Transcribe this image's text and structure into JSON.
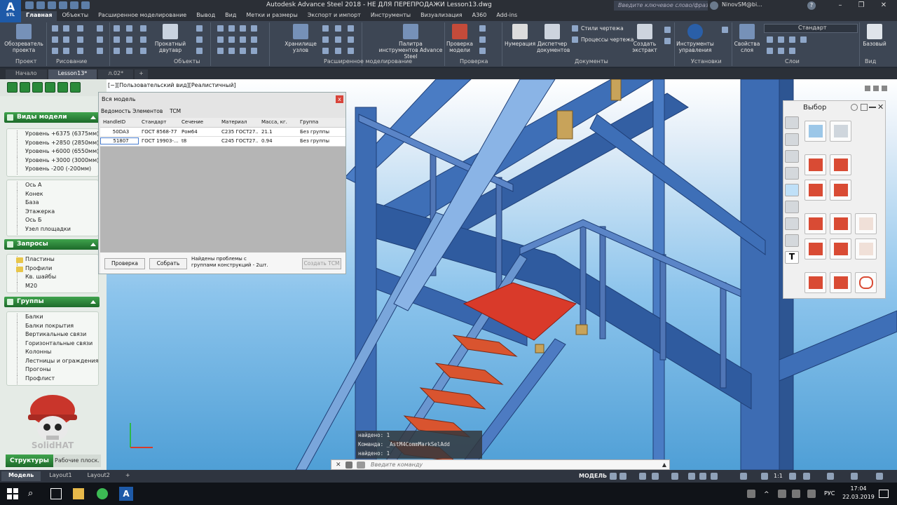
{
  "window": {
    "title": "Autodesk Advance Steel 2018 - НЕ ДЛЯ ПЕРЕПРОДАЖИ    Lesson13.dwg",
    "logo": "A",
    "logo_sub": "STL",
    "search_placeholder": "Введите ключевое слово/фразу",
    "user": "NinovSM@bi...",
    "minimize": "–",
    "restore": "❐",
    "close": "✕"
  },
  "ribbon_tabs": [
    "Главная",
    "Объекты",
    "Расширенное моделирование",
    "Вывод",
    "Вид",
    "Метки и размеры",
    "Экспорт и импорт",
    "Инструменты",
    "Визуализация",
    "A360",
    "Add-ins"
  ],
  "ribbon": {
    "buttons": {
      "project_browser": "Обозреватель проекта",
      "rolled_beam": "Прокатный двутавр",
      "storage_nodes": "Хранилище узлов",
      "tool_palette": "Палитра инструментов Advance Steel",
      "model_check": "Проверка модели",
      "numbering": "Нумерация",
      "doc_manager": "Диспетчер документов",
      "drawing_styles": "Стили чертежа",
      "drawing_processes": "Процессы чертежа",
      "create_extract": "Создать экстракт",
      "management_tools": "Инструменты управления",
      "layer_props": "Свойства слоя",
      "base": "Базовый",
      "layer_state": "Стандарт"
    },
    "groups": [
      "Проект",
      "Рисование",
      "Объекты",
      "Расширенное моделирование",
      "Проверка",
      "Документы",
      "Установки",
      "Слои",
      "Вид"
    ]
  },
  "doc_tabs": [
    "Начало",
    "Lesson13*",
    "л.02*"
  ],
  "left_panel": {
    "views_header": "Виды модели",
    "levels": [
      "Уровень +6375 (6375мм)",
      "Уровень +2850 (2850мм)",
      "Уровень +6000 (6550мм)",
      "Уровень +3000 (3000мм)",
      "Уровень -200 (-200мм)"
    ],
    "axes": [
      "Ось А",
      "Конек",
      "База",
      "Этажерка",
      "Ось Б",
      "Узел площадки"
    ],
    "queries_header": "Запросы",
    "queries": [
      "Пластины",
      "Профили",
      "Кв. шайбы",
      "M20"
    ],
    "groups_header": "Группы",
    "groups": [
      "Балки",
      "Балки покрытия",
      "Вертикальные связи",
      "Горизонтальные связи",
      "Колонны",
      "Лестницы и ограждения",
      "Прогоны",
      "Профлист"
    ],
    "mascot_text": "SolidHAT",
    "bottom_tabs": [
      "Структуры",
      "Рабочие плоск."
    ]
  },
  "viewport": {
    "label": "[−][Пользовательский вид][Реалистичный]"
  },
  "dialog": {
    "title": "Вся модель",
    "close": "x",
    "tabs": [
      "Ведомость Элементов",
      "TCM"
    ],
    "columns": [
      "HandleID",
      "Стандарт",
      "Сечение",
      "Материал",
      "Масса, кг.",
      "Группа"
    ],
    "rows": [
      [
        "50DA3",
        "ГОСТ 8568-77",
        "Ром64",
        "С235 ГОСТ27...",
        "21.1",
        "Без группы"
      ],
      [
        "51807",
        "ГОСТ 19903-...",
        "t8",
        "С245 ГОСТ27...",
        "0.94",
        "Без группы"
      ]
    ],
    "check_btn": "Проверка",
    "collect_btn": "Собрать",
    "message": "Найдены проблемы с группами конструкций - 2шт.",
    "create_btn": "Создать ТСМ"
  },
  "palette": {
    "title": "Выбор"
  },
  "command": {
    "history": [
      "найдено: 1",
      "Команда: _AstM4CommMarkSelAdd",
      "найдено: 1"
    ],
    "placeholder": "Введите команду"
  },
  "status": {
    "tabs": [
      "Модель",
      "Layout1",
      "Layout2"
    ],
    "model_label": "МОДЕЛЬ",
    "scale": "1:1"
  },
  "taskbar": {
    "lang": "РУС",
    "time": "17:04",
    "date": "22.03.2019"
  },
  "colors": {
    "accent": "#2a8a3a",
    "steel": "#3a6fb5",
    "highlight": "#d93a2a",
    "stairs": "#d9542f"
  }
}
